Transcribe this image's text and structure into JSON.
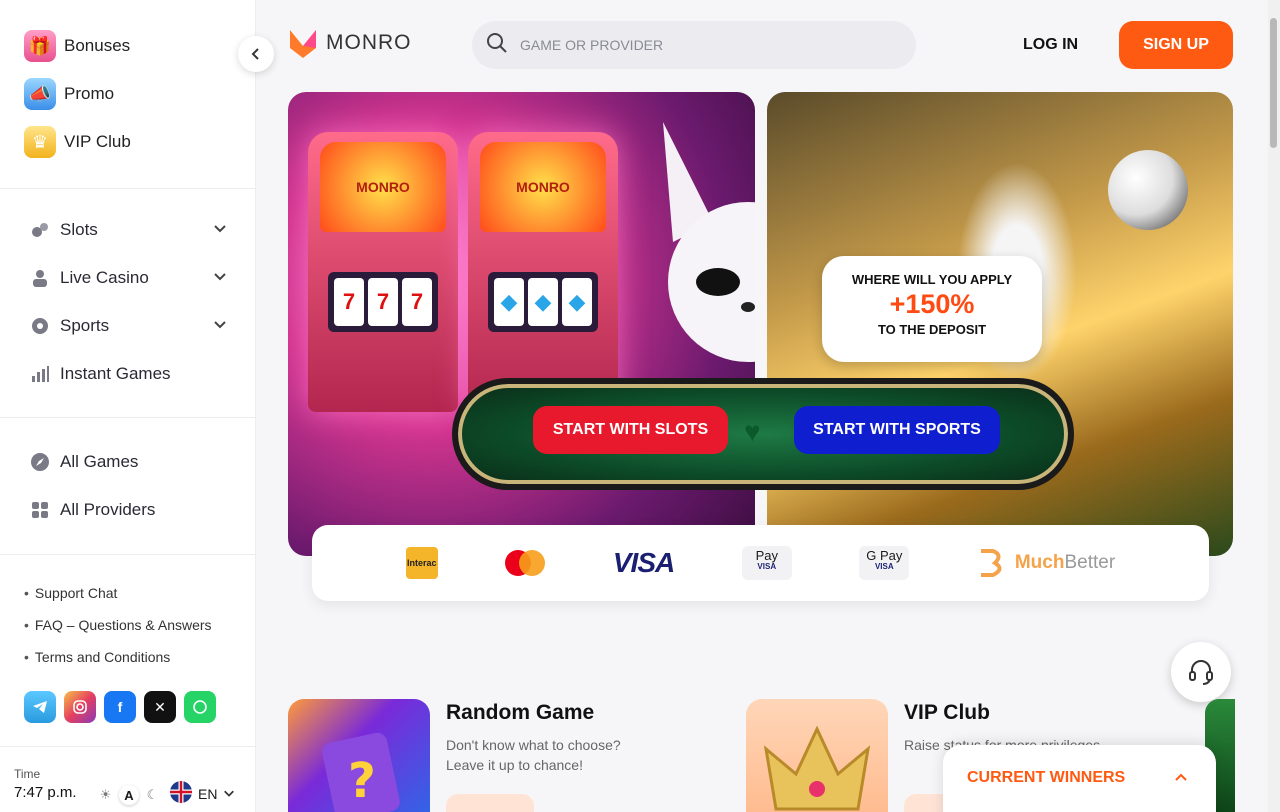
{
  "sidebar": {
    "top_links": [
      {
        "label": "Bonuses",
        "icon": "gift-icon"
      },
      {
        "label": "Promo",
        "icon": "megaphone-icon"
      },
      {
        "label": "VIP Club",
        "icon": "crown-icon"
      }
    ],
    "nav": [
      {
        "label": "Slots",
        "icon": "slots-icon",
        "expandable": true
      },
      {
        "label": "Live Casino",
        "icon": "dealer-icon",
        "expandable": true
      },
      {
        "label": "Sports",
        "icon": "soccer-ball-icon",
        "expandable": true
      },
      {
        "label": "Instant Games",
        "icon": "chart-bars-icon",
        "expandable": false
      }
    ],
    "nav2": [
      {
        "label": "All Games",
        "icon": "compass-icon"
      },
      {
        "label": "All Providers",
        "icon": "grid-icon"
      }
    ],
    "help_links": [
      "Support Chat",
      "FAQ – Questions & Answers",
      "Terms and Conditions"
    ],
    "socials": [
      "telegram-icon",
      "instagram-icon",
      "facebook-icon",
      "x-icon",
      "whatsapp-icon"
    ],
    "time_label": "Time",
    "time_value": "7:47 p.m.",
    "theme_auto_label": "A",
    "language": "EN"
  },
  "header": {
    "logo_text": "MONRO",
    "search_placeholder": "GAME OR PROVIDER",
    "login_label": "LOG IN",
    "signup_label": "SIGN UP"
  },
  "hero": {
    "slot_brand_1": "MONRO",
    "slot_brand_2": "MONRO",
    "bubble_line1": "WHERE WILL YOU APPLY",
    "bubble_line2": "+150%",
    "bubble_line3": "TO THE DEPOSIT",
    "btn_slots": "START WITH SLOTS",
    "btn_sports": "START WITH SPORTS"
  },
  "payments": {
    "interac": "Interac",
    "visa": "VISA",
    "apple_pay": "Pay",
    "google_pay": "G Pay",
    "wallet_sub": "VISA",
    "muchbetter_much": "Much",
    "muchbetter_better": "Better"
  },
  "cards": [
    {
      "title": "Random Game",
      "desc_line1": "Don't know what to choose?",
      "desc_line2": "Leave it up to chance!"
    },
    {
      "title": "VIP Club",
      "desc_line1": "Raise status for more privileges",
      "desc_line2": ""
    }
  ],
  "winners": {
    "title": "CURRENT WINNERS"
  },
  "colors": {
    "accent": "#ff5a12",
    "slots_btn": "#e8192c",
    "sports_btn": "#0f1fd0"
  }
}
